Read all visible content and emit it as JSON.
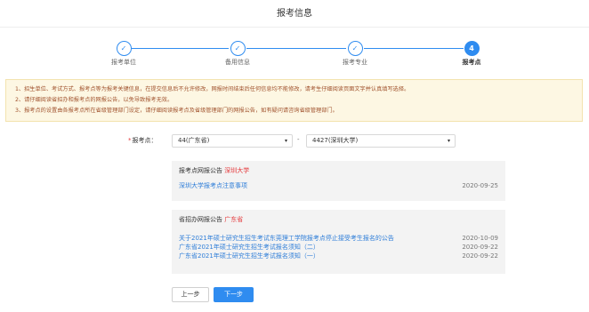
{
  "page": {
    "title": "报考信息"
  },
  "steps": [
    {
      "label": "报考单位",
      "status": "done",
      "symbol": "✓"
    },
    {
      "label": "备用信息",
      "status": "done",
      "symbol": "✓"
    },
    {
      "label": "报考专业",
      "status": "done",
      "symbol": "✓"
    },
    {
      "label": "报考点",
      "status": "active",
      "symbol": "4"
    }
  ],
  "notice": {
    "lines": [
      "1、招生单位、考试方式、报考点等为报考关键信息，在提交信息后不允许修改，网报时间结束后任何信息均不能修改，请考生仔细阅读页面文字并认真填写选择。",
      "2、请仔细阅读省招办和报考点的网报公告，以免导致报考无效。",
      "3、报考点的设置由各报考点所在省级管理部门设定，请仔细阅读报考点及省级管理部门的网报公告，如有疑问请咨询省级管理部门。"
    ]
  },
  "form": {
    "required_mark": "*",
    "label": "报考点：",
    "province_select": "44(广东省)",
    "separator": "-",
    "site_select": "4427(深圳大学)",
    "caret": "▾"
  },
  "site_panel": {
    "title": "报考点网报公告",
    "title_highlight": "深圳大学",
    "items": [
      {
        "text": "深圳大学报考点注意事项",
        "date": "2020-09-25"
      }
    ]
  },
  "province_panel": {
    "title": "省招办网报公告",
    "title_highlight": "广东省",
    "items": [
      {
        "text": "关于2021年硕士研究生招生考试东莞理工学院报考点停止接受考生报名的公告",
        "date": "2020-10-09"
      },
      {
        "text": "广东省2021年硕士研究生招生考试报名须知（二）",
        "date": "2020-09-22"
      },
      {
        "text": "广东省2021年硕士研究生招生考试报名须知（一）",
        "date": "2020-09-22"
      }
    ]
  },
  "buttons": {
    "prev": "上一步",
    "next": "下一步"
  },
  "colors": {
    "accent": "#2f8cf0",
    "highlight": "#e4393c",
    "link": "#2f7ed8",
    "notice_bg": "#fdf7e3",
    "notice_text": "#a0522d"
  }
}
